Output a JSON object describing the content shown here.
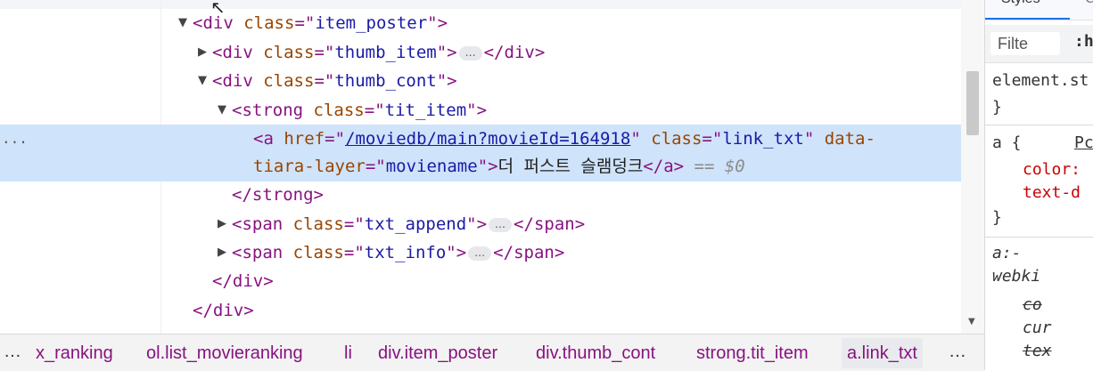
{
  "dom": {
    "lines": [
      {
        "indent": 216,
        "tri": "open",
        "parts": [
          [
            "punct",
            "<"
          ],
          [
            "tag",
            "div"
          ],
          [
            "txt",
            " "
          ],
          [
            "attr",
            "class"
          ],
          [
            "punct",
            "=\""
          ],
          [
            "val",
            "item_poster"
          ],
          [
            "punct",
            "\">"
          ]
        ]
      },
      {
        "indent": 238,
        "tri": "closed",
        "parts": [
          [
            "punct",
            "<"
          ],
          [
            "tag",
            "div"
          ],
          [
            "txt",
            " "
          ],
          [
            "attr",
            "class"
          ],
          [
            "punct",
            "=\""
          ],
          [
            "val",
            "thumb_item"
          ],
          [
            "punct",
            "\">"
          ],
          [
            "ell",
            "…"
          ],
          [
            "punct",
            "</"
          ],
          [
            "tag",
            "div"
          ],
          [
            "punct",
            ">"
          ]
        ]
      },
      {
        "indent": 238,
        "tri": "open",
        "parts": [
          [
            "punct",
            "<"
          ],
          [
            "tag",
            "div"
          ],
          [
            "txt",
            " "
          ],
          [
            "attr",
            "class"
          ],
          [
            "punct",
            "=\""
          ],
          [
            "val",
            "thumb_cont"
          ],
          [
            "punct",
            "\">"
          ]
        ]
      },
      {
        "indent": 260,
        "tri": "open",
        "parts": [
          [
            "punct",
            "<"
          ],
          [
            "tag",
            "strong"
          ],
          [
            "txt",
            " "
          ],
          [
            "attr",
            "class"
          ],
          [
            "punct",
            "=\""
          ],
          [
            "val",
            "tit_item"
          ],
          [
            "punct",
            "\">"
          ]
        ]
      },
      {
        "indent": 284,
        "tri": "",
        "parts": [
          [
            "punct",
            "<"
          ],
          [
            "tag",
            "a"
          ],
          [
            "txt",
            " "
          ],
          [
            "attr",
            "href"
          ],
          [
            "punct",
            "=\""
          ],
          [
            "link",
            "/moviedb/main?movieId=164918"
          ],
          [
            "punct",
            "\""
          ],
          [
            "txt",
            " "
          ],
          [
            "attr",
            "class"
          ],
          [
            "punct",
            "=\""
          ],
          [
            "val",
            "link_txt"
          ],
          [
            "punct",
            "\""
          ],
          [
            "txt",
            " "
          ],
          [
            "attr",
            "data-"
          ]
        ]
      },
      {
        "indent": 284,
        "tri": "",
        "parts": [
          [
            "attr",
            "tiara-layer"
          ],
          [
            "punct",
            "=\""
          ],
          [
            "val",
            "moviename"
          ],
          [
            "punct",
            "\">"
          ],
          [
            "txt",
            "더 퍼스트 슬램덩크"
          ],
          [
            "punct",
            "</"
          ],
          [
            "tag",
            "a"
          ],
          [
            "punct",
            ">"
          ],
          [
            "txt",
            " "
          ],
          [
            "eq",
            "== $0"
          ]
        ]
      },
      {
        "indent": 260,
        "tri": "",
        "parts": [
          [
            "punct",
            "</"
          ],
          [
            "tag",
            "strong"
          ],
          [
            "punct",
            ">"
          ]
        ]
      },
      {
        "indent": 260,
        "tri": "closed",
        "parts": [
          [
            "punct",
            "<"
          ],
          [
            "tag",
            "span"
          ],
          [
            "txt",
            " "
          ],
          [
            "attr",
            "class"
          ],
          [
            "punct",
            "=\""
          ],
          [
            "val",
            "txt_append"
          ],
          [
            "punct",
            "\">"
          ],
          [
            "ell",
            "…"
          ],
          [
            "punct",
            "</"
          ],
          [
            "tag",
            "span"
          ],
          [
            "punct",
            ">"
          ]
        ]
      },
      {
        "indent": 260,
        "tri": "closed",
        "parts": [
          [
            "punct",
            "<"
          ],
          [
            "tag",
            "span"
          ],
          [
            "txt",
            " "
          ],
          [
            "attr",
            "class"
          ],
          [
            "punct",
            "=\""
          ],
          [
            "val",
            "txt_info"
          ],
          [
            "punct",
            "\">"
          ],
          [
            "ell",
            "…"
          ],
          [
            "punct",
            "</"
          ],
          [
            "tag",
            "span"
          ],
          [
            "punct",
            ">"
          ]
        ]
      },
      {
        "indent": 238,
        "tri": "",
        "parts": [
          [
            "punct",
            "</"
          ],
          [
            "tag",
            "div"
          ],
          [
            "punct",
            ">"
          ]
        ]
      },
      {
        "indent": 216,
        "tri": "",
        "parts": [
          [
            "punct",
            "</"
          ],
          [
            "tag",
            "div"
          ],
          [
            "punct",
            ">"
          ]
        ]
      }
    ],
    "left_dots": "..."
  },
  "styles_pane": {
    "tab_styles": "Styles",
    "tab_computed": "C",
    "filter_placeholder": "Filte",
    "hov_label": ":h",
    "rule1_selector": "element.st",
    "rule1_close": "}",
    "rule2_selector": "a {",
    "rule2_source": "Pc",
    "rule2_prop1": "color:",
    "rule2_prop2": "text-d",
    "rule2_close": "}",
    "rule3_selector_a": "a:-",
    "rule3_selector_b": "webki",
    "rule3_prop1": "co",
    "rule3_prop2": "cur",
    "rule3_prop3": "tex"
  },
  "breadcrumbs": {
    "leading_ellipsis": "…",
    "items": [
      "x_ranking",
      "ol.list_movieranking",
      "li",
      "div.item_poster",
      "div.thumb_cont",
      "strong.tit_item",
      "a.link_txt"
    ],
    "trailing_ellipsis": "…"
  },
  "colors": {
    "tag": "#881280",
    "attr": "#994500",
    "value": "#1a1aa6",
    "selected_row": "#cfe3fb",
    "accent": "#1a73e8"
  }
}
